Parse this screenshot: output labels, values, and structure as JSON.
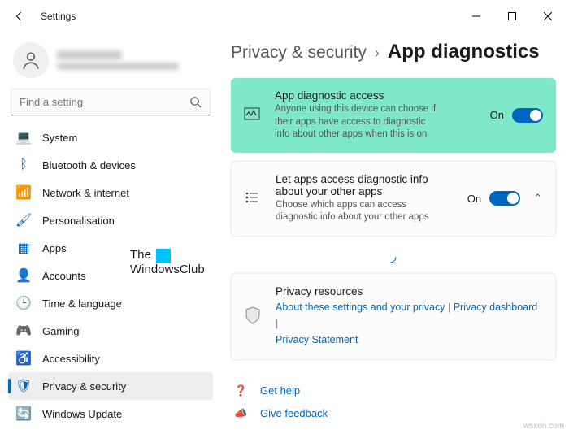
{
  "window": {
    "title": "Settings"
  },
  "search": {
    "placeholder": "Find a setting"
  },
  "nav": {
    "items": [
      {
        "label": "System",
        "icon": "system-icon",
        "glyph": "💻"
      },
      {
        "label": "Bluetooth & devices",
        "icon": "bluetooth-icon",
        "glyph": "ᛒ"
      },
      {
        "label": "Network & internet",
        "icon": "wifi-icon",
        "glyph": "📶"
      },
      {
        "label": "Personalisation",
        "icon": "personalisation-icon",
        "glyph": "🖌"
      },
      {
        "label": "Apps",
        "icon": "apps-icon",
        "glyph": "▦"
      },
      {
        "label": "Accounts",
        "icon": "accounts-icon",
        "glyph": "👤"
      },
      {
        "label": "Time & language",
        "icon": "time-icon",
        "glyph": "🕒"
      },
      {
        "label": "Gaming",
        "icon": "gaming-icon",
        "glyph": "🎮"
      },
      {
        "label": "Accessibility",
        "icon": "accessibility-icon",
        "glyph": "♿"
      },
      {
        "label": "Privacy & security",
        "icon": "shield-icon",
        "glyph": "🛡"
      },
      {
        "label": "Windows Update",
        "icon": "update-icon",
        "glyph": "🔄"
      }
    ],
    "active_index": 9
  },
  "breadcrumb": {
    "parent": "Privacy & security",
    "current": "App diagnostics"
  },
  "cards": {
    "diag_access": {
      "title": "App diagnostic access",
      "desc": "Anyone using this device can choose if their apps have access to diagnostic info about other apps when this is on",
      "toggle_label": "On"
    },
    "let_apps": {
      "title": "Let apps access diagnostic info about your other apps",
      "desc": "Choose which apps can access diagnostic info about your other apps",
      "toggle_label": "On"
    },
    "privacy": {
      "title": "Privacy resources",
      "link1": "About these settings and your privacy",
      "link2": "Privacy dashboard",
      "link3": "Privacy Statement"
    }
  },
  "footer": {
    "help": "Get help",
    "feedback": "Give feedback"
  },
  "watermark": {
    "line1": "The",
    "line2": "WindowsClub"
  },
  "source_tag": "wsxdn.com"
}
